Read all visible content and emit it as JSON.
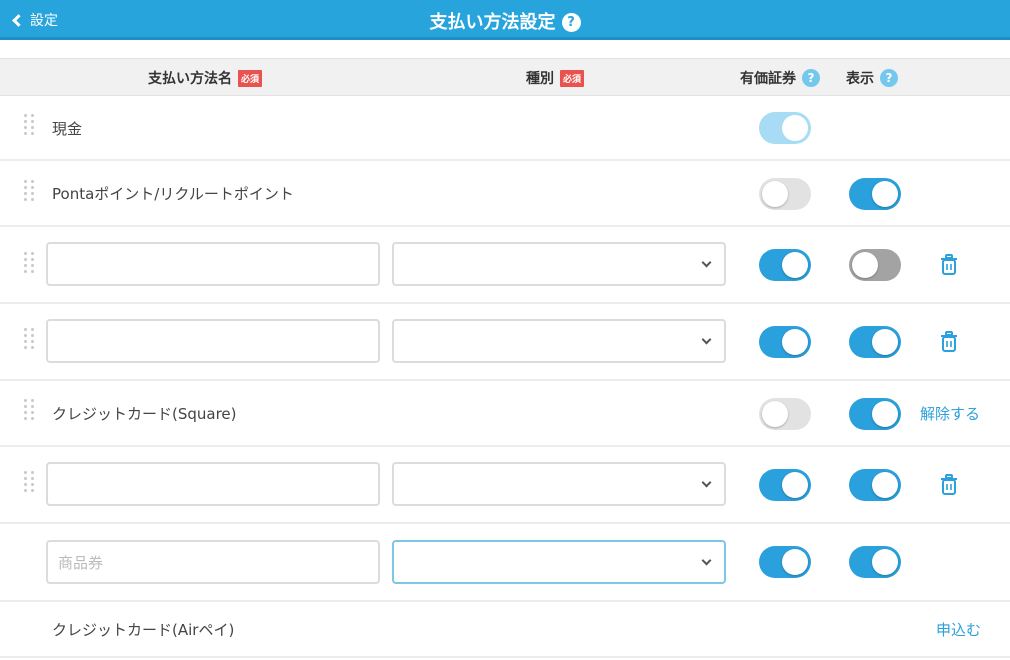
{
  "nav": {
    "back_label": "設定",
    "title": "支払い方法設定",
    "help_glyph": "?"
  },
  "columns": {
    "name": "支払い方法名",
    "type": "種別",
    "required_badge": "必須",
    "securities": "有価証券",
    "display": "表示",
    "help_glyph": "?"
  },
  "rows": [
    {
      "kind": "static",
      "name": "現金",
      "securities": "on-disabled",
      "display": null,
      "action": null
    },
    {
      "kind": "static",
      "name": "Pontaポイント/リクルートポイント",
      "securities": "off",
      "display": "on",
      "action": null
    },
    {
      "kind": "editable",
      "name_value": "",
      "type_value": "",
      "securities": "on",
      "display": "off",
      "action": "delete"
    },
    {
      "kind": "editable",
      "name_value": "",
      "type_value": "",
      "securities": "on",
      "display": "on",
      "action": "delete"
    },
    {
      "kind": "static",
      "name": "クレジットカード(Square)",
      "securities": "off",
      "display": "on",
      "action": "解除する"
    },
    {
      "kind": "editable",
      "name_value": "",
      "type_value": "",
      "securities": "on",
      "display": "on",
      "action": "delete"
    },
    {
      "kind": "new",
      "name_placeholder": "商品券",
      "type_value": "",
      "securities": "on",
      "display": "on",
      "action": null
    },
    {
      "kind": "static",
      "name": "クレジットカード(Airペイ)",
      "securities": null,
      "display": null,
      "action": "申込む"
    }
  ],
  "colors": {
    "accent": "#27a4dc",
    "required": "#e9534f",
    "toggle_off": "#e2e2e2"
  },
  "icons": {
    "back": "chevron-left-icon",
    "help": "question-circle-icon",
    "drag": "drag-handle-icon",
    "delete": "trash-icon",
    "dropdown": "chevron-down-icon"
  }
}
